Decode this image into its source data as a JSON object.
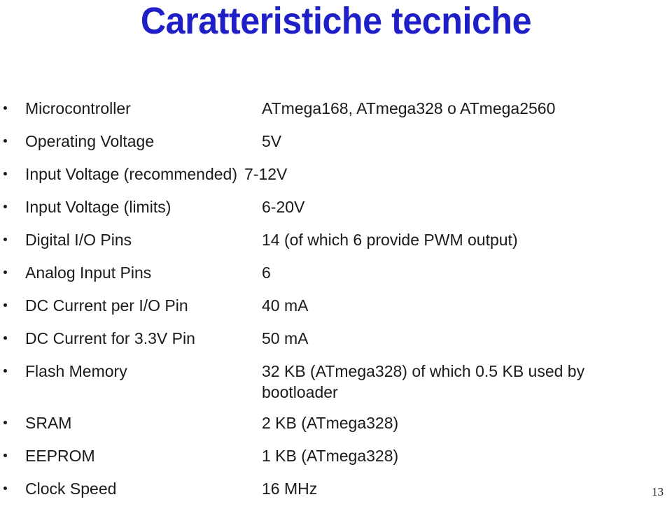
{
  "slide": {
    "title": "Caratteristiche tecniche",
    "title_color": "#1f1fc8",
    "text_color": "#1a1a1a",
    "background_color": "#ffffff",
    "page_number": "13"
  },
  "specs": [
    {
      "label": "Microcontroller",
      "value": "ATmega168, ATmega328 o  ATmega2560"
    },
    {
      "label": "Operating Voltage",
      "value": "5V"
    },
    {
      "label": "Input Voltage (recommended)",
      "value": "7-12V"
    },
    {
      "label": "Input Voltage (limits)",
      "value": "6-20V"
    },
    {
      "label": "Digital I/O Pins",
      "value": "14 (of which 6 provide PWM output)"
    },
    {
      "label": "Analog Input Pins",
      "value": "6"
    },
    {
      "label": "DC Current per I/O Pin",
      "value": "40 mA"
    },
    {
      "label": "DC Current for 3.3V Pin",
      "value": "50 mA"
    },
    {
      "label": "Flash Memory",
      "value": "32 KB (ATmega328) of which 0.5 KB used by bootloader"
    },
    {
      "label": "SRAM",
      "value": "2 KB (ATmega328)"
    },
    {
      "label": "EEPROM",
      "value": "1 KB (ATmega328)"
    },
    {
      "label": "Clock Speed",
      "value": "16 MHz"
    }
  ]
}
